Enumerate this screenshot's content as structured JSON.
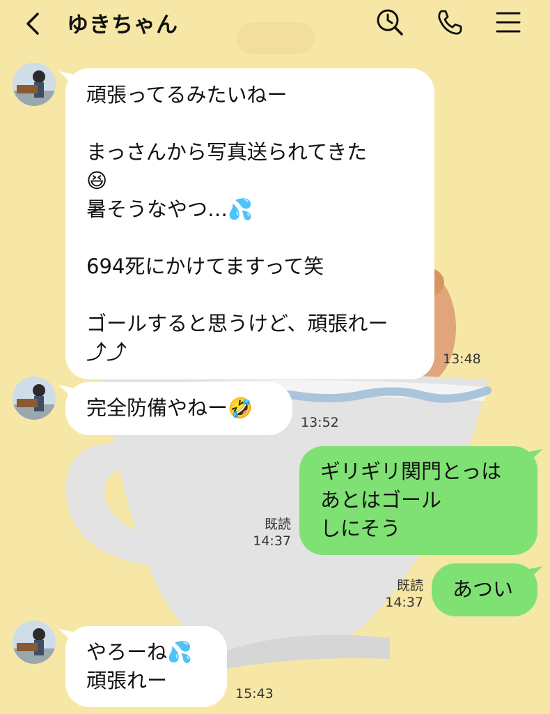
{
  "header": {
    "title": "ゆきちゃん",
    "back_icon": "chevron-left-icon",
    "search_icon": "search-clock-icon",
    "call_icon": "phone-icon",
    "menu_icon": "hamburger-menu-icon"
  },
  "colors": {
    "background": "#f7e7a6",
    "incoming_bubble": "#ffffff",
    "outgoing_bubble": "#7fe173"
  },
  "messages": [
    {
      "direction": "incoming",
      "text": "頑張ってるみたいねー\n\nまっさんから写真送られてきた\n😆\n暑そうなやつ…💦\n\n694死にかけてますって笑\n\nゴールすると思うけど、頑張れー\n⤴︎⤴︎",
      "time": "13:48"
    },
    {
      "direction": "incoming",
      "text": "完全防備やねー🤣",
      "time": "13:52"
    },
    {
      "direction": "outgoing",
      "text": "ギリギリ関門とっは\nあとはゴール\nしにそう",
      "read": "既読",
      "time": "14:37"
    },
    {
      "direction": "outgoing",
      "text": "あつい",
      "read": "既読",
      "time": "14:37"
    },
    {
      "direction": "incoming",
      "text": "やろーね💦\n頑張れー",
      "time": "15:43"
    }
  ]
}
